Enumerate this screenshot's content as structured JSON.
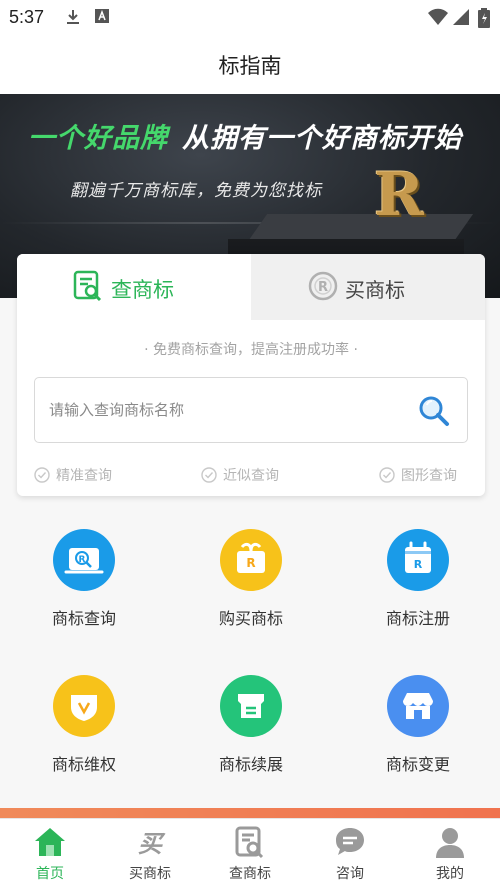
{
  "status_bar": {
    "time": "5:37"
  },
  "app_bar": {
    "title": "标指南"
  },
  "banner": {
    "slogan_green": "一个好品牌",
    "slogan_white": "从拥有一个好商标开始",
    "subtitle": "翻遍千万商标库，免费为您找标",
    "logo_letter": "R"
  },
  "search_card": {
    "tabs": [
      {
        "label": "查商标",
        "active": true
      },
      {
        "label": "买商标",
        "active": false
      }
    ],
    "tagline": "· 免费商标查询，提高注册成功率 ·",
    "search_placeholder": "请输入查询商标名称",
    "features": [
      "精准查询",
      "近似查询",
      "图形查询"
    ]
  },
  "services": [
    {
      "label": "商标查询",
      "icon": "trademark-search-icon",
      "color": "#1a9be8"
    },
    {
      "label": "购买商标",
      "icon": "buy-trademark-icon",
      "color": "#f7c21a"
    },
    {
      "label": "商标注册",
      "icon": "trademark-register-icon",
      "color": "#1a9be8"
    },
    {
      "label": "商标维权",
      "icon": "trademark-protect-icon",
      "color": "#f7c21a"
    },
    {
      "label": "商标续展",
      "icon": "trademark-renew-icon",
      "color": "#24c47a"
    },
    {
      "label": "商标变更",
      "icon": "trademark-change-icon",
      "color": "#4a8ff0"
    }
  ],
  "bottom_nav": [
    {
      "label": "首页",
      "icon": "home-icon",
      "active": true
    },
    {
      "label": "买商标",
      "icon": "buy-icon",
      "active": false
    },
    {
      "label": "查商标",
      "icon": "search-doc-icon",
      "active": false
    },
    {
      "label": "咨询",
      "icon": "chat-icon",
      "active": false
    },
    {
      "label": "我的",
      "icon": "user-icon",
      "active": false
    }
  ],
  "colors": {
    "accent_green": "#2cb558",
    "nav_accent": "#f0734f"
  }
}
